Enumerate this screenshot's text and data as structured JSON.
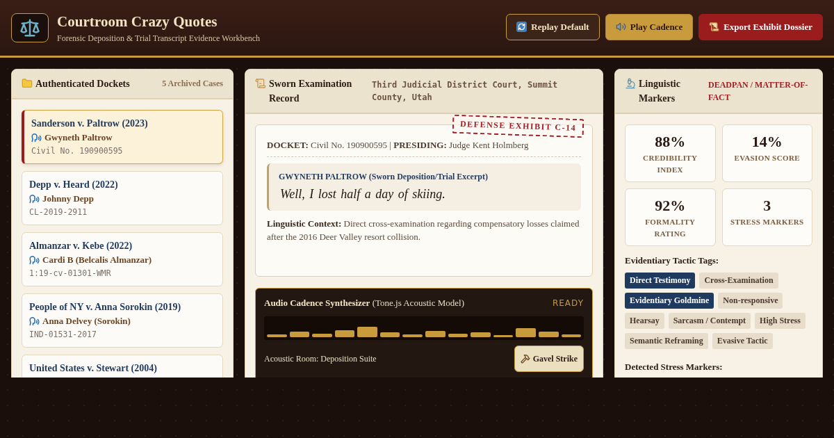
{
  "header": {
    "title": "Courtroom Crazy Quotes",
    "subtitle": "Forensic Deposition & Trial Transcript Evidence Workbench",
    "buttons": [
      {
        "label": "Replay Default",
        "kind": "outline"
      },
      {
        "label": "Play Cadence",
        "kind": "gold"
      },
      {
        "label": "Export Exhibit Dossier",
        "kind": "danger"
      }
    ]
  },
  "dockets": {
    "title": "Authenticated Dockets",
    "count": "5 Archived Cases",
    "items": [
      {
        "case": "Sanderson v. Paltrow (2023)",
        "speaker": "Gwyneth Paltrow",
        "docket": "Civil No. 190900595",
        "selected": true
      },
      {
        "case": "Depp v. Heard (2022)",
        "speaker": "Johnny Depp",
        "docket": "CL-2019-2911",
        "selected": false
      },
      {
        "case": "Almanzar v. Kebe (2022)",
        "speaker": "Cardi B (Belcalis Almanzar)",
        "docket": "1:19-cv-01301-WMR",
        "selected": false
      },
      {
        "case": "People of NY v. Anna Sorokin (2019)",
        "speaker": "Anna Delvey (Sorokin)",
        "docket": "IND-01531-2017",
        "selected": false
      },
      {
        "case": "United States v. Stewart (2004)",
        "selected": false
      }
    ]
  },
  "record": {
    "title": "Sworn Examination Record",
    "court": "Third Judicial District Court, Summit County, Utah",
    "meta": "**DOCKET:** Civil No. 190900595 | **PRESIDING:** Judge Kent Holmberg",
    "stamp": "DEFENSE EXHIBIT C-14",
    "speaker": "GWYNETH PALTROW (Sworn Deposition/Trial Excerpt)",
    "quote": "Well, I lost half a day of skiing.",
    "context": "**Linguistic Context:** Direct cross-examination regarding compensatory losses claimed after the 2016 Deer Valley resort collision."
  },
  "synth": {
    "title": "**Audio Cadence Synthesizer** (Tone.js Acoustic Model)",
    "status": "READY",
    "room": "Acoustic Room: Deposition Suite",
    "button": "Gavel Strike"
  },
  "markers": {
    "title": "Linguistic Markers",
    "tone": "DEADPAN / MATTER-OF-FACT",
    "stats": [
      {
        "value": "88%",
        "label": "CREDIBILITY INDEX"
      },
      {
        "value": "14%",
        "label": "EVASION SCORE"
      },
      {
        "value": "92%",
        "label": "FORMALITY RATING"
      },
      {
        "value": "3",
        "label": "STRESS MARKERS"
      }
    ],
    "tags_title": "Evidentiary Tactic Tags:",
    "tags": [
      {
        "label": "Direct Testimony",
        "selected": true
      },
      {
        "label": "Cross-Examination",
        "selected": false
      },
      {
        "label": "Evidentiary Goldmine",
        "selected": true
      },
      {
        "label": "Non-responsive",
        "selected": false
      },
      {
        "label": "Hearsay",
        "selected": false
      },
      {
        "label": "Sarcasm / Contempt",
        "selected": false
      },
      {
        "label": "High Stress",
        "selected": false
      },
      {
        "label": "Semantic Reframing",
        "selected": false
      },
      {
        "label": "Evasive Tactic",
        "selected": false
      }
    ],
    "stress_title": "Detected Stress Markers:"
  }
}
